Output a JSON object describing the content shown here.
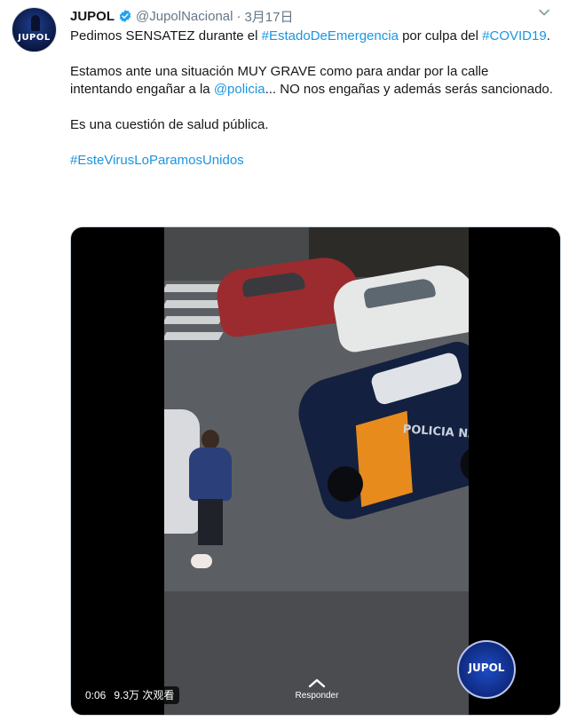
{
  "tweet": {
    "author_name": "JUPOL",
    "handle": "@JupolNacional",
    "separator": "·",
    "date": "3月17日",
    "avatar_text": "JUPOL",
    "verified_icon": "verified-badge-icon",
    "menu_icon": "chevron-down-icon"
  },
  "body": {
    "line1_pre": "Pedimos SENSATEZ durante el ",
    "line1_link": "#EstadoDeEmergencia",
    "line1_post": " por culpa del ",
    "line1_link2": "#COVID19",
    "line1_end": ".",
    "para2_pre": "Estamos ante una situación MUY GRAVE como para andar por la calle intentando engañar a la ",
    "para2_link": "@policia",
    "para2_post": "... NO nos engañas y además serás sancionado.",
    "para3": "Es una cuestión de salud pública.",
    "hashtag": "#EsteVirusLoParamosUnidos"
  },
  "media": {
    "time": "0:06",
    "views": "9.3万 次观看",
    "reply_label": "Responder",
    "police_text": "POLICIA NACIONAL",
    "logo_text": "JUPOL"
  },
  "colors": {
    "link": "#1b95e0",
    "text": "#14171a",
    "muted": "#657786",
    "verified": "#1da1f2"
  }
}
